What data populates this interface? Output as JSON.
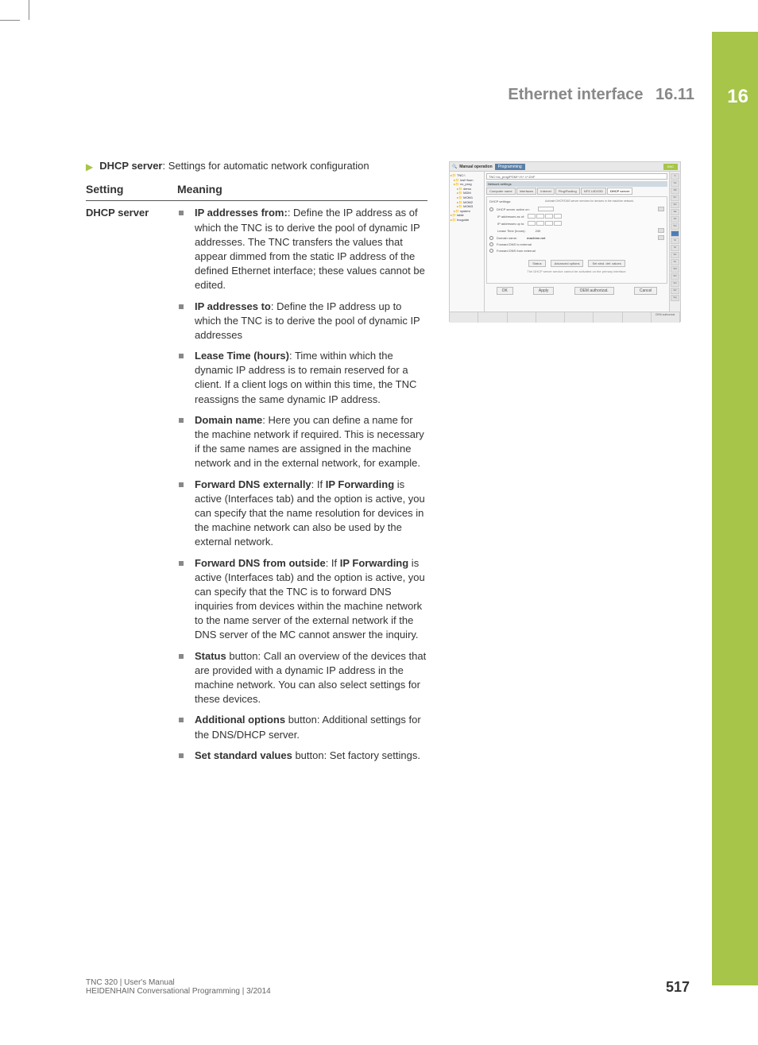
{
  "header": {
    "title": "Ethernet interface",
    "section_number": "16.11",
    "chapter": "16"
  },
  "intro": {
    "label": "DHCP server",
    "desc": ": Settings for automatic network configuration"
  },
  "table": {
    "col1": "Setting",
    "col2": "Meaning",
    "setting_name": "DHCP server",
    "items": [
      {
        "bold": "IP addresses from:",
        "text": ": Define the IP address as of which the TNC is to derive the pool of dynamic IP addresses. The TNC transfers the values that appear dimmed from the static IP address of the defined Ethernet interface; these values cannot be edited."
      },
      {
        "bold": "IP addresses to",
        "text": ": Define the IP address up to which the TNC is to derive the pool of dynamic IP addresses"
      },
      {
        "bold": "Lease Time (hours)",
        "text": ": Time within which the dynamic IP address is to remain reserved for a client. If a client logs on within this time, the TNC reassigns the same dynamic IP address."
      },
      {
        "bold": "Domain name",
        "text": ": Here you can define a name for the machine network if required. This is necessary if the same names are assigned in the machine network and in the external network, for example."
      },
      {
        "bold": "Forward DNS externally",
        "text_prefix": ": If ",
        "bold2": "IP Forwarding",
        "text": " is active (Interfaces tab) and the option is active, you can specify that the name resolution for devices in the machine network can also be used by the external network."
      },
      {
        "bold": "Forward DNS from outside",
        "text_prefix": ": If ",
        "bold2": "IP Forwarding",
        "text": " is active (Interfaces tab) and the option is active, you can specify that the TNC is to forward DNS inquiries from devices within the machine network to the name server of the external network if the DNS server of the MC cannot answer the inquiry."
      },
      {
        "bold": "Status",
        "text": " button: Call an overview of the devices that are provided with a dynamic IP address in the machine network. You can also select settings for these devices."
      },
      {
        "bold": "Additional options",
        "text": " button: Additional settings for the DNS/DHCP server."
      },
      {
        "bold": "Set standard values",
        "text": " button: Set factory settings."
      }
    ]
  },
  "screenshot": {
    "mode1": "Manual operation",
    "mode2": "Programming",
    "dnc": "DNC",
    "tree": [
      "TNC:\\",
      "lost+foun",
      "nc_prog",
      "demo",
      "MDM",
      "MOM1",
      "MOM2",
      "MOM3",
      "system",
      "table",
      "tncguide"
    ],
    "window_title": "Network settings",
    "path": "TNC:\\nc_prog\\PGM\\*.H;*.I;*.DXF",
    "tabs": [
      "Computer name",
      "Interfaces",
      "Internet",
      "Ping/Routing",
      "NFS UID/GID",
      "DHCP server"
    ],
    "active_tab": 5,
    "form_header": "DHCP settings:",
    "form_note": "Activate DHCP/DNS server services for devices in the machine network.",
    "rows": {
      "r1": "DHCP server active on:",
      "r2": "IP addresses as of:",
      "r3": "IP addresses up to:",
      "r4": "Lease Time (hours):",
      "r4v": "240",
      "r5": "Domain name:",
      "r5v": "machine.net",
      "r6": "Forward DNS to external",
      "r7": "Forward DNS from external"
    },
    "buttons": {
      "b1": "Status",
      "b2": "Advanced options",
      "b3": "Set stnd. def. values"
    },
    "note": "The DHCP server service cannot be activated on the primary interface.",
    "bottom_buttons": [
      "OK",
      "Apply",
      "OEM authorizat.",
      "Cancel"
    ],
    "right_labels": [
      "S",
      "SA",
      "SB",
      "SC",
      "SD",
      "SE",
      "SF",
      "SG",
      "SH",
      "SI",
      "SJ",
      "SK",
      "SL",
      "SM",
      "SN",
      "SO",
      "SP",
      "SQ"
    ],
    "softkeys": [
      "",
      "",
      "",
      "",
      "",
      "",
      "",
      "OEM authorizat."
    ]
  },
  "footer": {
    "line1": "TNC 320 | User's Manual",
    "line2": "HEIDENHAIN Conversational Programming | 3/2014",
    "page": "517"
  }
}
